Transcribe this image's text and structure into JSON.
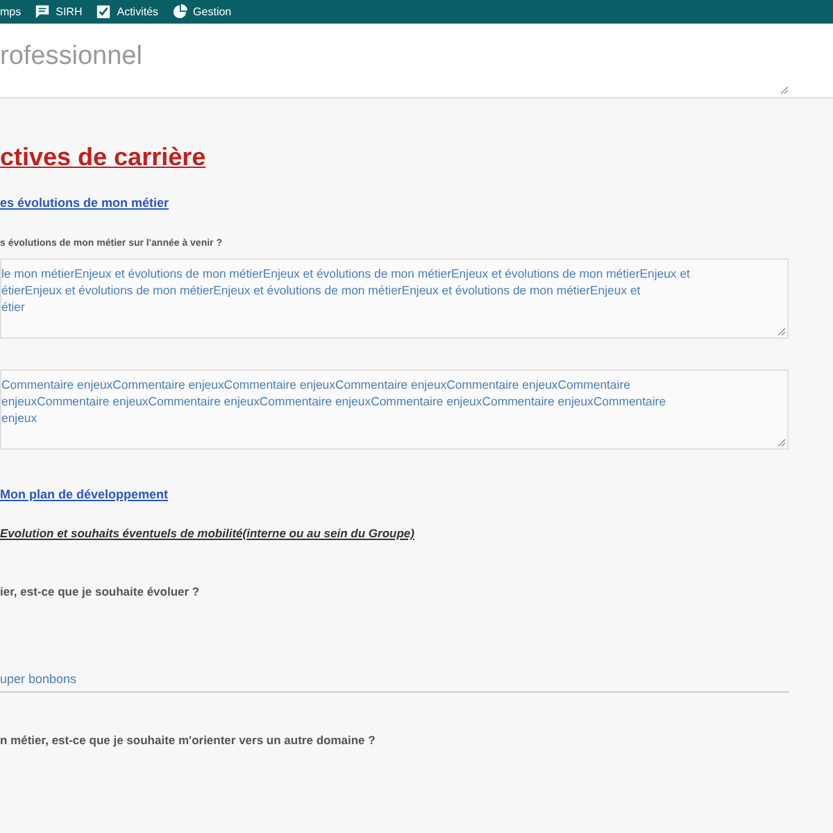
{
  "nav": [
    {
      "label": "mps"
    },
    {
      "label": "SIRH"
    },
    {
      "label": "Activités"
    },
    {
      "label": "Gestion"
    }
  ],
  "title_field": {
    "value": "rofessionnel"
  },
  "section_title": "ctives de carrière",
  "blocks": [
    {
      "kind": "link",
      "text": "es évolutions de mon métier"
    },
    {
      "kind": "note",
      "text": "s évolutions de mon métier sur l'année à venir ?"
    },
    {
      "kind": "textarea",
      "value": "le mon métierEnjeux et évolutions de mon métierEnjeux et évolutions de mon métierEnjeux et évolutions de mon métierEnjeux et\nétierEnjeux et évolutions de mon métierEnjeux et évolutions de mon métierEnjeux et évolutions de mon métierEnjeux et\nétier"
    },
    {
      "kind": "textarea",
      "value": "Commentaire enjeuxCommentaire enjeuxCommentaire enjeuxCommentaire enjeuxCommentaire enjeuxCommentaire\nenjeuxCommentaire enjeuxCommentaire enjeuxCommentaire enjeuxCommentaire enjeuxCommentaire enjeuxCommentaire\nenjeux"
    },
    {
      "kind": "link",
      "text": "Mon plan de développement"
    },
    {
      "kind": "subheading",
      "text": "Evolution et souhaits éventuels de mobilité(interne ou au sein du Groupe)"
    },
    {
      "kind": "question",
      "text": "ier, est-ce que je souhaite évoluer ?"
    },
    {
      "kind": "input",
      "value": "uper bonbons"
    },
    {
      "kind": "question",
      "text": "n métier, est-ce que je souhaite m'orienter vers un autre domaine ?"
    }
  ]
}
